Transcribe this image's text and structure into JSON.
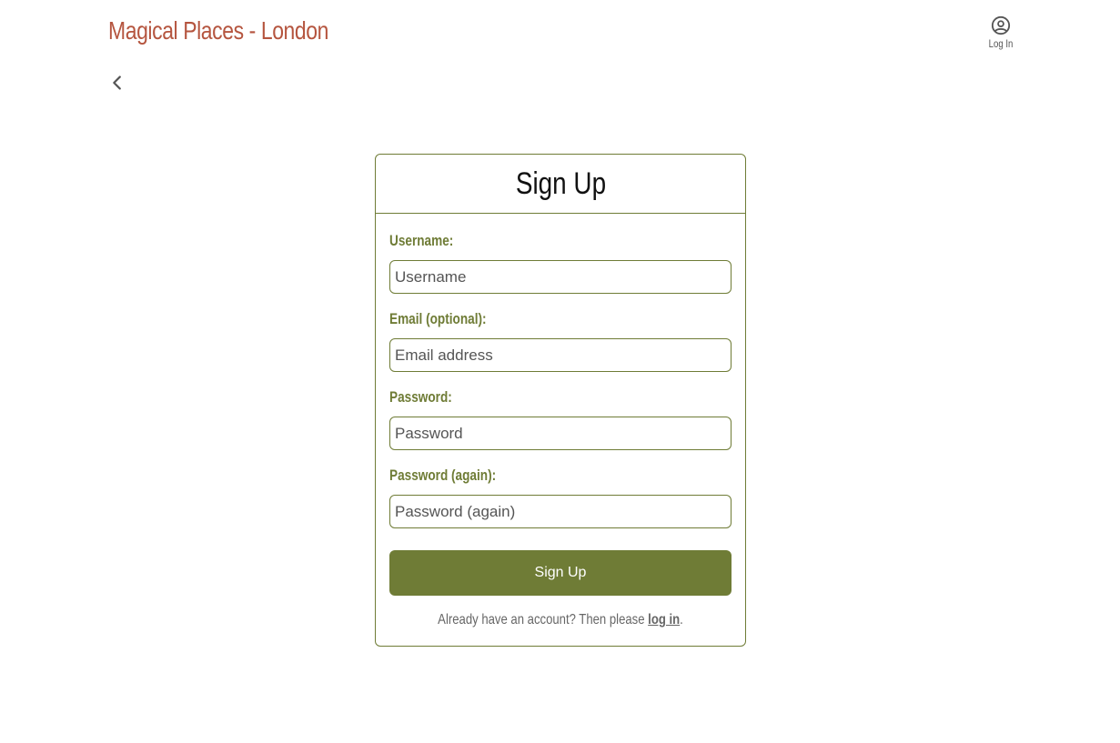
{
  "header": {
    "site_title": "Magical Places - London",
    "login_label": "Log In",
    "login_icon": "user-circle-icon",
    "back_icon": "chevron-left-icon"
  },
  "form": {
    "title": "Sign Up",
    "fields": [
      {
        "label": "Username:",
        "placeholder": "Username",
        "value": ""
      },
      {
        "label": "Email (optional):",
        "placeholder": "Email address",
        "value": ""
      },
      {
        "label": "Password:",
        "placeholder": "Password",
        "value": ""
      },
      {
        "label": "Password (again):",
        "placeholder": "Password (again)",
        "value": ""
      }
    ],
    "submit_label": "Sign Up",
    "footer_prefix": "Already have an account? Then please ",
    "footer_link": "log in",
    "footer_suffix": "."
  },
  "colors": {
    "brand": "#b5553f",
    "accent": "#6f7c36"
  }
}
